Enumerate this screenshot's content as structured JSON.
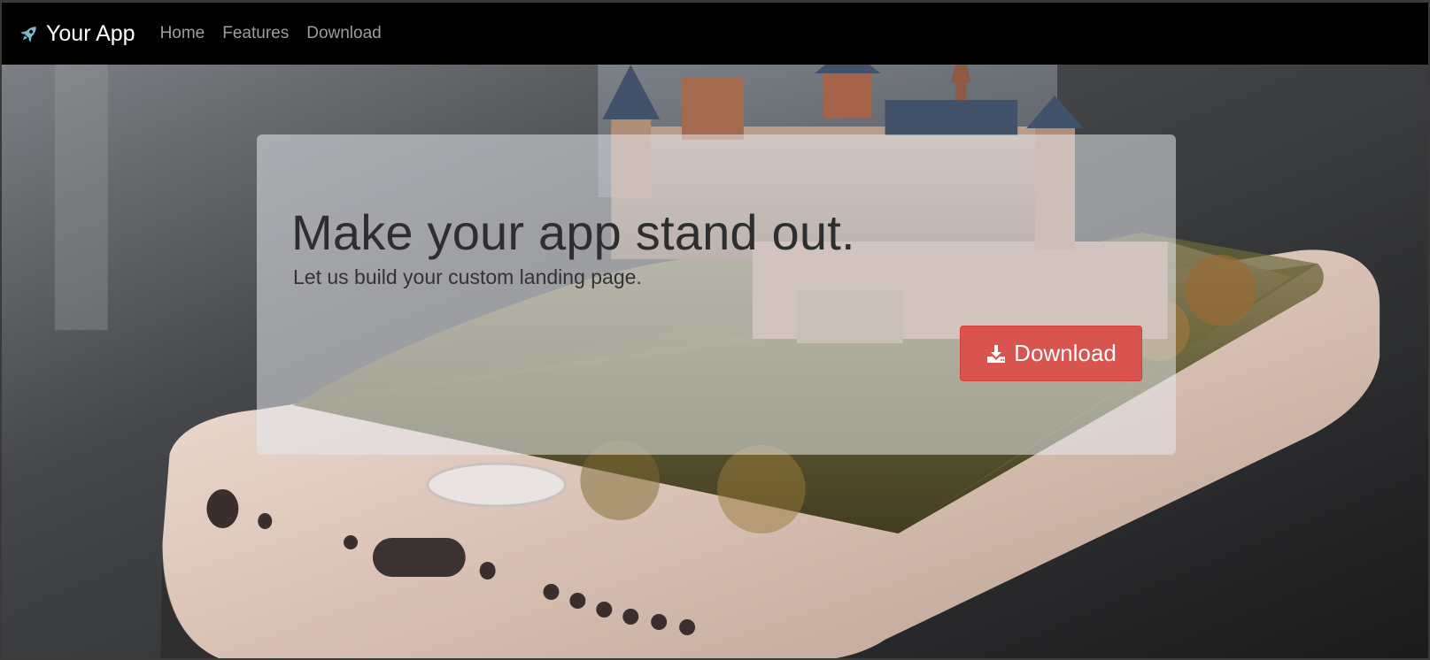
{
  "navbar": {
    "brand_icon": "rocket-icon",
    "brand_label": "Your App",
    "links": [
      {
        "label": "Home"
      },
      {
        "label": "Features"
      },
      {
        "label": "Download"
      }
    ]
  },
  "hero": {
    "background_image": "smartphone-with-castle-on-forested-hill",
    "title": "Make your app stand out.",
    "subtitle": "Let us build your custom landing page.",
    "download_button": {
      "icon": "download-icon",
      "label": "Download"
    }
  },
  "colors": {
    "navbar_bg": "#000000",
    "nav_link": "#9d9d9d",
    "brand_text": "#ffffff",
    "button_bg": "#d9534f",
    "rocket": "#7fb8c9"
  }
}
